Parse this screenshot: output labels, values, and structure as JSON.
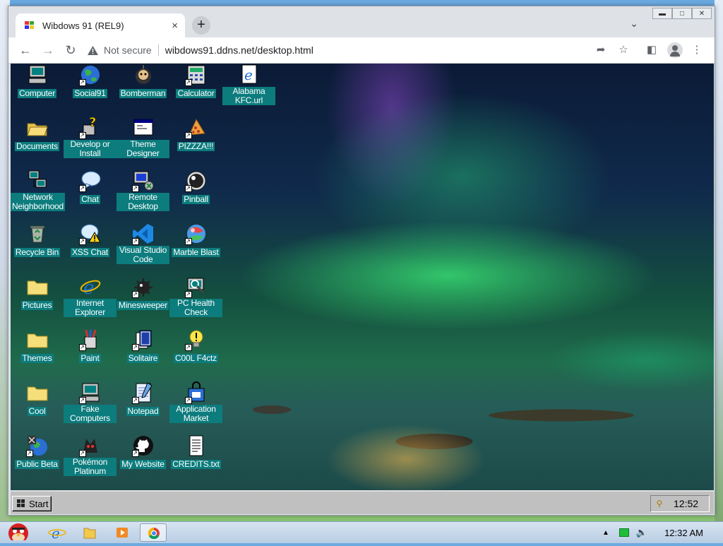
{
  "browser": {
    "tab_title": "Wibdows 91 (REL9)",
    "tab_close": "×",
    "new_tab": "+",
    "security_label": "Not secure",
    "url": "wibdows91.ddns.net/desktop.html"
  },
  "desktop": {
    "icons": [
      {
        "label": "Computer",
        "icon": "computer-icon",
        "shortcut": false
      },
      {
        "label": "Social91",
        "icon": "globe-icon",
        "shortcut": true
      },
      {
        "label": "Bomberman",
        "icon": "bomberman-icon",
        "shortcut": false
      },
      {
        "label": "Calculator",
        "icon": "calculator-icon",
        "shortcut": true
      },
      {
        "label": "Alabama KFC.url",
        "icon": "ie-url-icon",
        "shortcut": false
      },
      {
        "label": "Documents",
        "icon": "open-folder-icon",
        "shortcut": false
      },
      {
        "label": "Develop or Install",
        "icon": "help-icon",
        "shortcut": true
      },
      {
        "label": "Theme Designer",
        "icon": "window-icon",
        "shortcut": false
      },
      {
        "label": "PIZZZA!!!",
        "icon": "pizza-icon",
        "shortcut": true
      },
      {
        "label": "Network Neighborhood",
        "icon": "network-icon",
        "shortcut": false
      },
      {
        "label": "Chat",
        "icon": "chat-bubble-icon",
        "shortcut": true
      },
      {
        "label": "Remote Desktop",
        "icon": "remote-desktop-icon",
        "shortcut": true
      },
      {
        "label": "Pinball",
        "icon": "pinball-icon",
        "shortcut": true
      },
      {
        "label": "Recycle Bin",
        "icon": "recycle-bin-icon",
        "shortcut": false
      },
      {
        "label": "XSS Chat",
        "icon": "warning-chat-icon",
        "shortcut": true
      },
      {
        "label": "Visual Studio Code",
        "icon": "vscode-icon",
        "shortcut": true
      },
      {
        "label": "Marble Blast",
        "icon": "marble-icon",
        "shortcut": true
      },
      {
        "label": "Pictures",
        "icon": "folder-icon",
        "shortcut": false
      },
      {
        "label": "Internet Explorer",
        "icon": "ie-icon",
        "shortcut": false
      },
      {
        "label": "Minesweeper",
        "icon": "mine-icon",
        "shortcut": true
      },
      {
        "label": "PC Health Check",
        "icon": "health-check-icon",
        "shortcut": true
      },
      {
        "label": "Themes",
        "icon": "folder-icon",
        "shortcut": false
      },
      {
        "label": "Paint",
        "icon": "paint-icon",
        "shortcut": true
      },
      {
        "label": "Solitaire",
        "icon": "solitaire-icon",
        "shortcut": true
      },
      {
        "label": "C00L F4ctz",
        "icon": "bulb-icon",
        "shortcut": true
      },
      {
        "label": "Cool",
        "icon": "folder-icon",
        "shortcut": false
      },
      {
        "label": "Fake Computers",
        "icon": "computer-icon",
        "shortcut": true
      },
      {
        "label": "Notepad",
        "icon": "notepad-icon",
        "shortcut": true
      },
      {
        "label": "Application Market",
        "icon": "market-icon",
        "shortcut": true
      },
      {
        "label": "Public Beta",
        "icon": "beta-globe-icon",
        "shortcut": true
      },
      {
        "label": "Pokémon Platinum",
        "icon": "pokemon-icon",
        "shortcut": true
      },
      {
        "label": "My Website",
        "icon": "github-icon",
        "shortcut": true
      },
      {
        "label": "CREDITS.txt",
        "icon": "text-file-icon",
        "shortcut": false
      }
    ],
    "start_label": "Start",
    "clock": "12:52"
  },
  "host": {
    "clock": "12:32 AM",
    "apps": [
      "angry-birds-icon",
      "ie-icon",
      "folder-icon",
      "media-player-icon",
      "chrome-icon"
    ]
  },
  "colors": {
    "icon_label_bg": "#0c7c7d",
    "win9x_gray": "#c0c0c0"
  }
}
